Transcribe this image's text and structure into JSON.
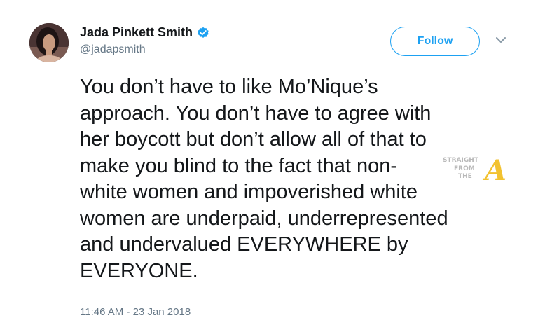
{
  "tweet": {
    "author_name": "Jada Pinkett Smith",
    "author_handle": "@jadapsmith",
    "verified": true,
    "follow_label": "Follow",
    "body_lines": [
      "You don’t have to like Mo’Nique’s",
      "approach. You don’t have to agree with",
      "her boycott but don’t allow all of that to",
      "make you blind to the fact that non-",
      "white women and impoverished white",
      "women are underpaid, underrepresented",
      "and undervalued EVERYWHERE by",
      "EVERYONE."
    ],
    "timestamp": "11:46 AM - 23 Jan 2018"
  },
  "watermark": {
    "line1": "STRAIGHT",
    "line2": "FROM",
    "line3": "THE",
    "letter": "A"
  },
  "icons": {
    "verified": "verified-badge-icon",
    "more": "chevron-down-icon"
  },
  "colors": {
    "accent": "#1da1f2",
    "text": "#14171a",
    "secondary": "#657786",
    "watermark_gold": "#f2c230"
  }
}
